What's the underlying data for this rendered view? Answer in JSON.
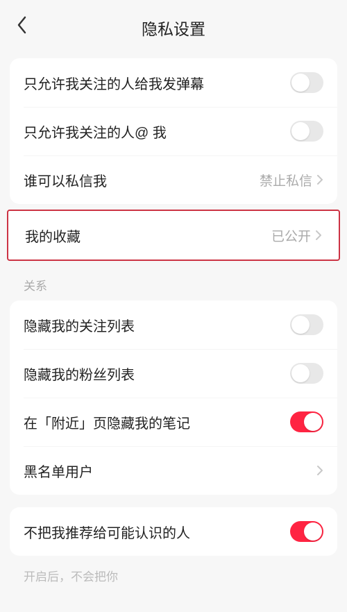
{
  "header": {
    "title": "隐私设置"
  },
  "group1": {
    "row1": {
      "label": "只允许我关注的人给我发弹幕",
      "toggle_on": false
    },
    "row2": {
      "label": "只允许我关注的人@ 我",
      "toggle_on": false
    },
    "row3": {
      "label": "谁可以私信我",
      "value": "禁止私信"
    }
  },
  "highlight": {
    "label": "我的收藏",
    "value": "已公开"
  },
  "section2_title": "关系",
  "group2": {
    "row1": {
      "label": "隐藏我的关注列表",
      "toggle_on": false
    },
    "row2": {
      "label": "隐藏我的粉丝列表",
      "toggle_on": false
    },
    "row3": {
      "label": "在「附近」页隐藏我的笔记",
      "toggle_on": true
    },
    "row4": {
      "label": "黑名单用户"
    }
  },
  "group3": {
    "row1": {
      "label": "不把我推荐给可能认识的人",
      "toggle_on": true
    }
  },
  "footer_note": "开启后，不会把你"
}
